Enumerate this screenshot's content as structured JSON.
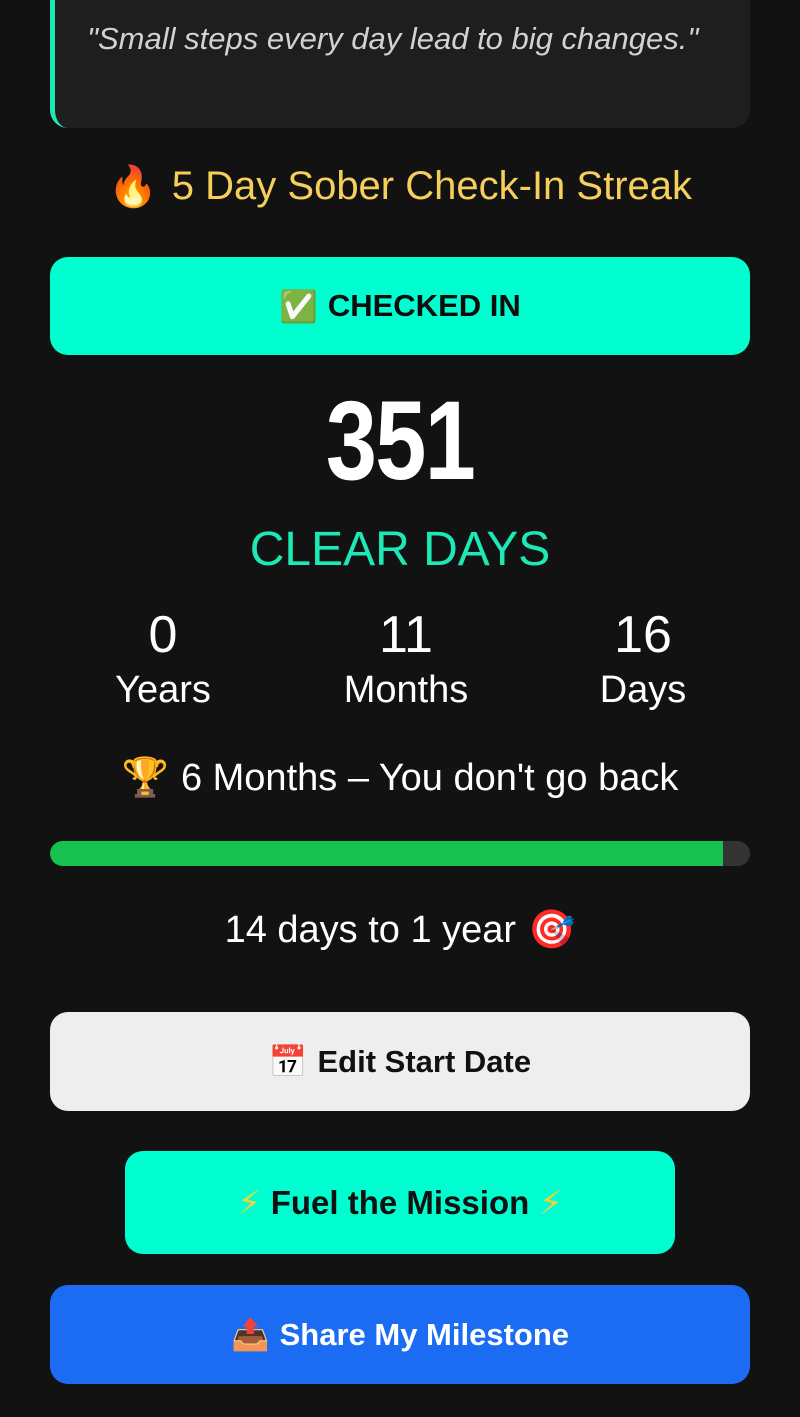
{
  "quote": {
    "text": "\"Small steps every day lead to big changes.\""
  },
  "streak": {
    "icon": "fire-icon",
    "emoji": "🔥",
    "label": "5 Day Sober Check-In Streak"
  },
  "checkin_button": {
    "emoji": "✅",
    "label": "CHECKED IN"
  },
  "counter": {
    "total_days": "351",
    "label": "CLEAR DAYS"
  },
  "breakdown": [
    {
      "value": "0",
      "unit": "Years"
    },
    {
      "value": "11",
      "unit": "Months"
    },
    {
      "value": "16",
      "unit": "Days"
    }
  ],
  "milestone": {
    "emoji": "🏆",
    "text": "6 Months – You don't go back"
  },
  "progress": {
    "fraction": 0.962,
    "color": "#16c14f"
  },
  "next_goal": {
    "text": "14 days to 1 year",
    "emoji": "🎯"
  },
  "edit_button": {
    "emoji": "📅",
    "label": "Edit Start Date"
  },
  "fuel_button": {
    "emoji": "⚡",
    "label": "Fuel the Mission"
  },
  "share_button": {
    "emoji": "📤",
    "label": "Share My Milestone"
  },
  "colors": {
    "background": "#121212",
    "accent": "#00ffd0",
    "streak": "#f6cf5b",
    "share": "#1b6cf2"
  }
}
